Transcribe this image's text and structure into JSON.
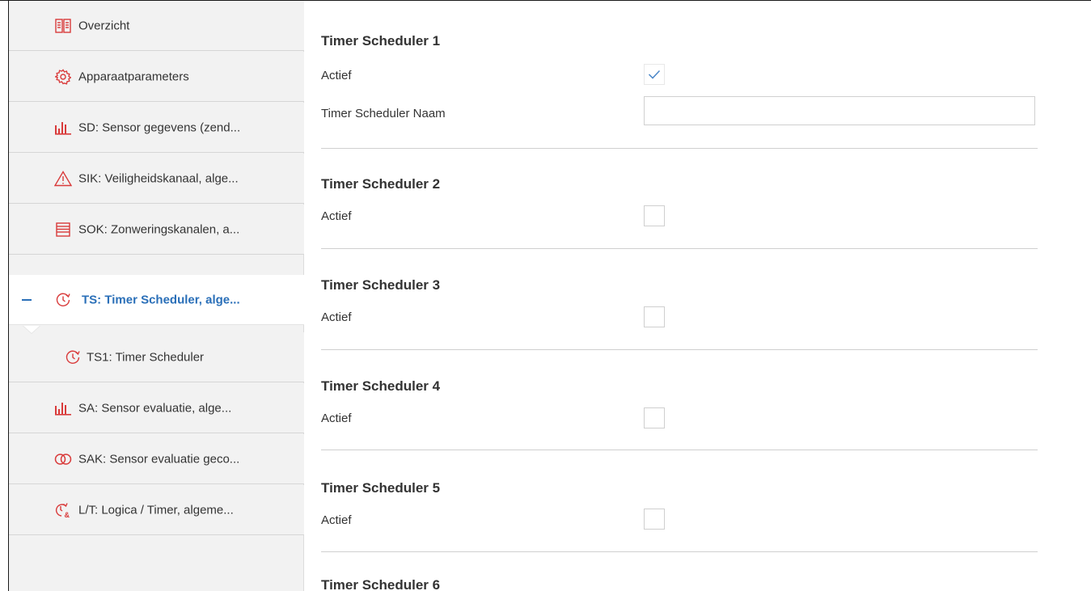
{
  "sidebar": {
    "items": [
      {
        "label": "Overzicht",
        "icon": "book-icon"
      },
      {
        "label": "Apparaatparameters",
        "icon": "gear-icon"
      },
      {
        "label": "SD: Sensor gegevens (zend...",
        "icon": "bar-chart-icon"
      },
      {
        "label": "SIK: Veiligheidskanaal, alge...",
        "icon": "warning-icon"
      },
      {
        "label": "SOK: Zonweringskanalen, a...",
        "icon": "shutter-icon"
      },
      {
        "label": "TS: Timer Scheduler, alge...",
        "icon": "timer-icon",
        "active": true
      },
      {
        "label": "TS1:  Timer Scheduler",
        "icon": "timer-icon"
      },
      {
        "label": "SA: Sensor evaluatie, alge...",
        "icon": "bar-chart-icon"
      },
      {
        "label": "SAK: Sensor evaluatie geco...",
        "icon": "linked-circles-icon"
      },
      {
        "label": "L/T: Logica / Timer, algeme...",
        "icon": "logic-timer-icon"
      }
    ]
  },
  "main": {
    "sections": [
      {
        "title": "Timer Scheduler 1",
        "actief_label": "Actief",
        "actief_checked": true,
        "name_label": "Timer Scheduler Naam",
        "name_value": ""
      },
      {
        "title": "Timer Scheduler 2",
        "actief_label": "Actief",
        "actief_checked": false
      },
      {
        "title": "Timer Scheduler 3",
        "actief_label": "Actief",
        "actief_checked": false
      },
      {
        "title": "Timer Scheduler 4",
        "actief_label": "Actief",
        "actief_checked": false
      },
      {
        "title": "Timer Scheduler 5",
        "actief_label": "Actief",
        "actief_checked": false
      },
      {
        "title": "Timer Scheduler 6"
      }
    ]
  },
  "colors": {
    "icon_red": "#d93b3b",
    "active_blue": "#2a6fb8",
    "checkmark_blue": "#4a86c8"
  }
}
